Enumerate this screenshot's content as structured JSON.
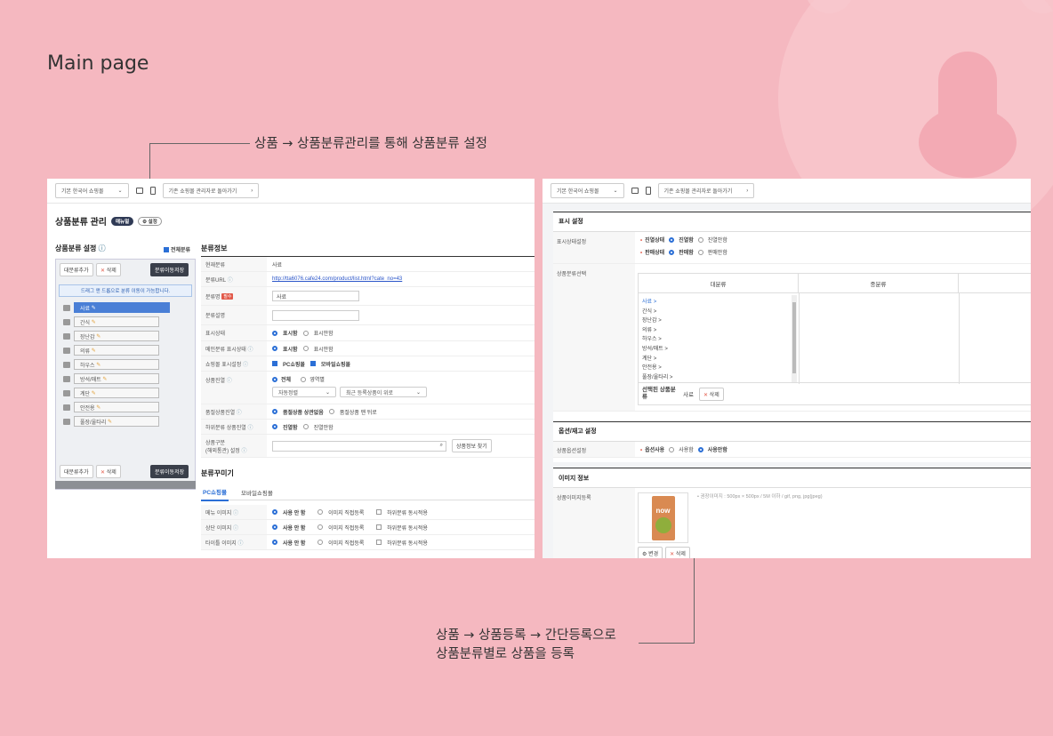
{
  "page": {
    "title": "Main page"
  },
  "annotations": {
    "top": "상품 → 상품분류관리를 통해 상품분류 설정",
    "bottom_line1": "상품 → 상품등록 → 간단등록으로",
    "bottom_line2": "상품분류별로 상품을 등록"
  },
  "left": {
    "shop_select": "기본 한국어 쇼핑몰",
    "return_link": "기존 쇼핑몰 관리자로 돌아가기",
    "page_title": "상품분류 관리",
    "badge_manual": "매뉴얼",
    "badge_settings": "설정",
    "section_title": "상품분류 설정",
    "expand_all": "전체분류",
    "btn_add_big": "대분류추가",
    "btn_delete": "삭제",
    "btn_save_move": "분류이동저장",
    "drag_hint": "드래그 앤 드롭으로 분류 이동이 가능합니다.",
    "tree": [
      "사료",
      "간식",
      "장난감",
      "의류",
      "하우스",
      "방석/매트",
      "계단",
      "안전용",
      "풀장/울타리"
    ],
    "info_title": "분류정보",
    "rows": {
      "current": {
        "label": "현재분류",
        "value": "사료"
      },
      "url": {
        "label": "분류URL",
        "value": "http://tta6076.cafe24.com/product/list.html?cate_no=43"
      },
      "name": {
        "label": "분류명",
        "tag": "필수",
        "value": "사료"
      },
      "desc": {
        "label": "분류설명"
      },
      "display": {
        "label": "표시상태",
        "on": "표시함",
        "off": "표시안함"
      },
      "main_display": {
        "label": "메인분류 표시상태",
        "on": "표시함",
        "off": "표시안함"
      },
      "mall_display": {
        "label": "쇼핑몰 표시설정",
        "pc": "PC쇼핑몰",
        "mobile": "모바일쇼핑몰"
      },
      "sort": {
        "label": "상품진열",
        "all": "전체",
        "each": "영역별",
        "sel1": "자동정렬",
        "sel2": "최근 등록상품이 위로"
      },
      "soldout": {
        "label": "품절상품진열",
        "opt1": "품절상품 상관없음",
        "opt2": "품절상품 맨 뒤로"
      },
      "sub_display": {
        "label": "하위분류 상품진열",
        "on": "진열함",
        "off": "진열안함"
      },
      "type": {
        "label1": "상품구분",
        "label2": "(해외통관) 설정",
        "btn": "상품정보 찾기"
      }
    },
    "deco_title": "분류꾸미기",
    "tabs": [
      "PC쇼핑몰",
      "모바일쇼핑몰"
    ],
    "images": [
      {
        "label": "메뉴 이미지",
        "opt1": "사용 안 함",
        "opt2": "이미지 직접등록",
        "opt3": "하위분류 동시적용"
      },
      {
        "label": "상단 이미지",
        "opt1": "사용 안 함",
        "opt2": "이미지 직접등록",
        "opt3": "하위분류 동시적용"
      },
      {
        "label": "타이틀 이미지",
        "opt1": "사용 안 함",
        "opt2": "이미지 직접등록",
        "opt3": "하위분류 동시적용"
      }
    ]
  },
  "right": {
    "shop_select": "기본 한국어 쇼핑몰",
    "return_link": "기존 쇼핑몰 관리자로 돌아가기",
    "display_title": "표시 설정",
    "display_label": "표시상태설정",
    "exhibit": {
      "name": "진열상태",
      "on": "진열함",
      "off": "진열안함"
    },
    "sale": {
      "name": "판매상태",
      "on": "판매함",
      "off": "판매안함"
    },
    "cat_label": "상품분류선택",
    "col_big": "대분류",
    "col_mid": "중분류",
    "cats": [
      "사료 >",
      "간식 >",
      "장난감 >",
      "의류 >",
      "하우스 >",
      "방석/매트 >",
      "계단 >",
      "안전용 >",
      "풀장/울타리 >"
    ],
    "selected_label": "선택된 상품분류",
    "selected_value": "사료",
    "delete": "삭제",
    "option_title": "옵션/재고 설정",
    "option_label": "상품옵션설정",
    "option_name": "옵션사용",
    "option_on": "사용함",
    "option_off": "사용안함",
    "image_title": "이미지 정보",
    "image_label": "상품이미지등록",
    "image_hint": "• 권장이미지 : 500px × 500px / 5M 이하 / gif, png, jpg(jpeg)",
    "btn_change": "변경",
    "btn_delete": "삭제",
    "product_text": "now"
  }
}
